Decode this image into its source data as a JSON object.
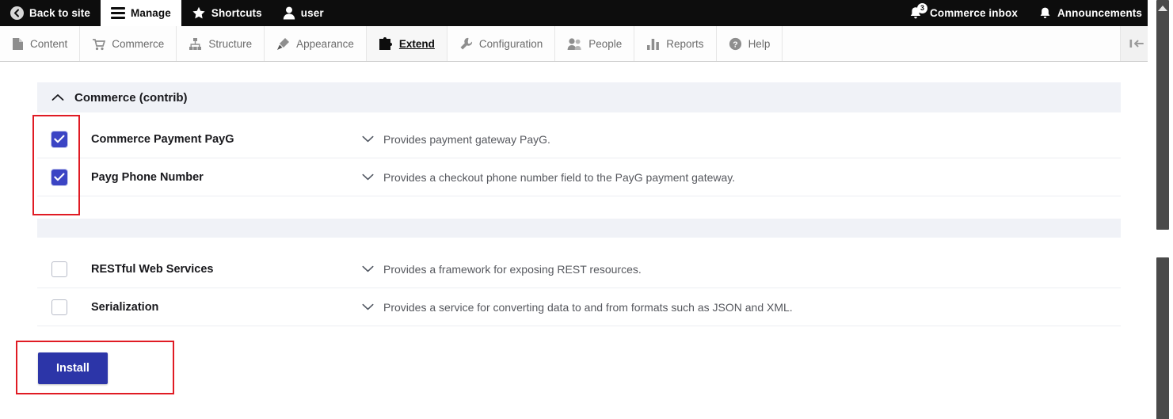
{
  "adminbar": {
    "items": [
      {
        "label": "Back to site",
        "icon": "back-arrow-icon",
        "active": false
      },
      {
        "label": "Manage",
        "icon": "hamburger-icon",
        "active": true
      },
      {
        "label": "Shortcuts",
        "icon": "star-icon",
        "active": false
      },
      {
        "label": "user",
        "icon": "user-icon",
        "active": false
      }
    ],
    "right_items": [
      {
        "label": "Commerce inbox",
        "icon": "bell-icon",
        "badge": "3"
      },
      {
        "label": "Announcements",
        "icon": "bell-icon",
        "badge": ""
      }
    ]
  },
  "tray": {
    "items": [
      {
        "label": "Content",
        "icon": "document-icon",
        "active": false
      },
      {
        "label": "Commerce",
        "icon": "shopping-cart-icon",
        "active": false
      },
      {
        "label": "Structure",
        "icon": "sitemap-icon",
        "active": false
      },
      {
        "label": "Appearance",
        "icon": "paintbrush-icon",
        "active": false
      },
      {
        "label": "Extend",
        "icon": "puzzle-piece-icon",
        "active": true
      },
      {
        "label": "Configuration",
        "icon": "wrench-icon",
        "active": false
      },
      {
        "label": "People",
        "icon": "people-icon",
        "active": false
      },
      {
        "label": "Reports",
        "icon": "bar-chart-icon",
        "active": false
      },
      {
        "label": "Help",
        "icon": "question-circle-icon",
        "active": false
      }
    ],
    "orientation_toggle_icon": "collapse-toolbar-icon"
  },
  "main": {
    "group": {
      "title": "Commerce (contrib)",
      "collapse_icon": "chevron-up-icon",
      "expanded": true
    },
    "modules": [
      {
        "name": "Commerce Payment PayG",
        "description": "Provides payment gateway PayG.",
        "checked": true,
        "expand_icon": "chevron-down-icon"
      },
      {
        "name": "Payg Phone Number",
        "description": "Provides a checkout phone number field to the PayG payment gateway.",
        "checked": true,
        "expand_icon": "chevron-down-icon"
      }
    ],
    "modules_lower": [
      {
        "name": "RESTful Web Services",
        "description": "Provides a framework for exposing REST resources.",
        "checked": false,
        "expand_icon": "chevron-down-icon"
      },
      {
        "name": "Serialization",
        "description": "Provides a service for converting data to and from formats such as JSON and XML.",
        "checked": false,
        "expand_icon": "chevron-down-icon"
      }
    ],
    "install_button_label": "Install"
  },
  "colors": {
    "accent_blue": "#2c35a8",
    "checkbox_blue": "#3b44c4",
    "annotation_red": "#e01b24",
    "group_header_bg": "#f0f2f7",
    "adminbar_bg": "#0d0d0d"
  }
}
